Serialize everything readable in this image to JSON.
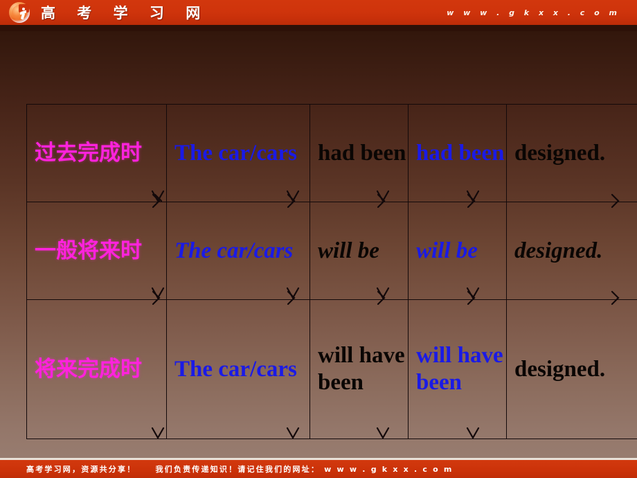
{
  "header": {
    "logo_icon": "gkxx-circle-logo-icon",
    "site_title": "高 考 学 习 网",
    "site_url": "w w w . g k x x . c o m",
    "background_color": "#cf340c"
  },
  "slide": {
    "background_gradient_top": "#2a1108",
    "background_gradient_bottom": "#9a8073"
  },
  "table": {
    "accent_chinese_color": "#ff22dd",
    "accent_blue_color": "#1a1ae6",
    "text_black_color": "#0a0604",
    "border_color": "#13090a",
    "rows": [
      {
        "tense": "过去完成时",
        "subject": "The car/cars",
        "aux_black": "had been",
        "aux_blue": "had been",
        "verb": "designed.",
        "italic": false
      },
      {
        "tense": "一般将来时",
        "subject": "The car/cars",
        "aux_black": "will be",
        "aux_blue": "will be",
        "verb": "designed.",
        "italic": true
      },
      {
        "tense": "将来完成时",
        "subject": "The car/cars",
        "aux_black": "will have been",
        "aux_blue": "will have been",
        "verb": "designed.",
        "italic": false
      }
    ]
  },
  "footer": {
    "part1": "高考学习网，资源共分享！",
    "part2": "我们负责传递知识！请记住我们的网址：",
    "part3": "w w w . g k x x . c o m",
    "background_color": "#cb3209"
  }
}
